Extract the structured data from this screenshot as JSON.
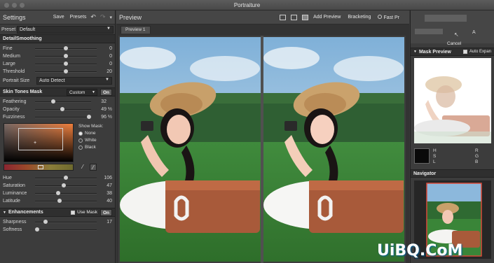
{
  "window": {
    "title": "Portraiture"
  },
  "settings": {
    "title": "Settings",
    "save_label": "Save",
    "presets_label": "Presets",
    "preset_label": "Preset",
    "preset_value": "Default"
  },
  "detail": {
    "title": "DetailSmoothing",
    "sliders": [
      {
        "label": "Fine",
        "value": "0",
        "pos": 0.5
      },
      {
        "label": "Medium",
        "value": "0",
        "pos": 0.5
      },
      {
        "label": "Large",
        "value": "0",
        "pos": 0.5
      },
      {
        "label": "Threshold",
        "value": "20",
        "pos": 0.5
      }
    ],
    "portrait_size_label": "Portrait Size",
    "portrait_size_value": "Auto Detect"
  },
  "skin": {
    "title": "Skin Tones Mask",
    "mode": "Custom",
    "toggle": "On",
    "sliders": [
      {
        "label": "Feathering",
        "value": "32",
        "unit": "",
        "pos": 0.32
      },
      {
        "label": "Opacity",
        "value": "49",
        "unit": "%",
        "pos": 0.49
      },
      {
        "label": "Fuzziness",
        "value": "96",
        "unit": "%",
        "pos": 0.96
      }
    ],
    "show_mask_label": "Show Mask:",
    "show_mask_options": [
      "None",
      "White",
      "Black"
    ],
    "show_mask_selected": 0,
    "hsl_sliders": [
      {
        "label": "Hue",
        "value": "106",
        "pos": 0.5
      },
      {
        "label": "Saturation",
        "value": "47",
        "pos": 0.47
      },
      {
        "label": "Luminance",
        "value": "38",
        "pos": 0.38
      },
      {
        "label": "Latitude",
        "value": "40",
        "pos": 0.4
      }
    ]
  },
  "enh": {
    "title": "Enhancements",
    "use_mask_label": "Use Mask",
    "toggle": "On",
    "sliders": [
      {
        "label": "Sharpness",
        "value": "17",
        "pos": 0.17
      },
      {
        "label": "Softness",
        "value": "",
        "pos": 0.0
      }
    ]
  },
  "preview": {
    "title": "Preview",
    "add_preview_label": "Add Preview",
    "bracketing_label": "Bracketing",
    "fast_preview_label": "Fast Pr",
    "tab_label": "Preview 1"
  },
  "right": {
    "cancel_label": "Cancel",
    "partial_label": "A",
    "mask_preview_title": "Mask Preview",
    "auto_expand_label": "Auto Expan",
    "hsl_labels": [
      "H",
      "S",
      "L"
    ],
    "rgb_labels": [
      "R",
      "G",
      "B"
    ],
    "navigator_title": "Navigator"
  },
  "watermark": "UiBQ.CoM"
}
